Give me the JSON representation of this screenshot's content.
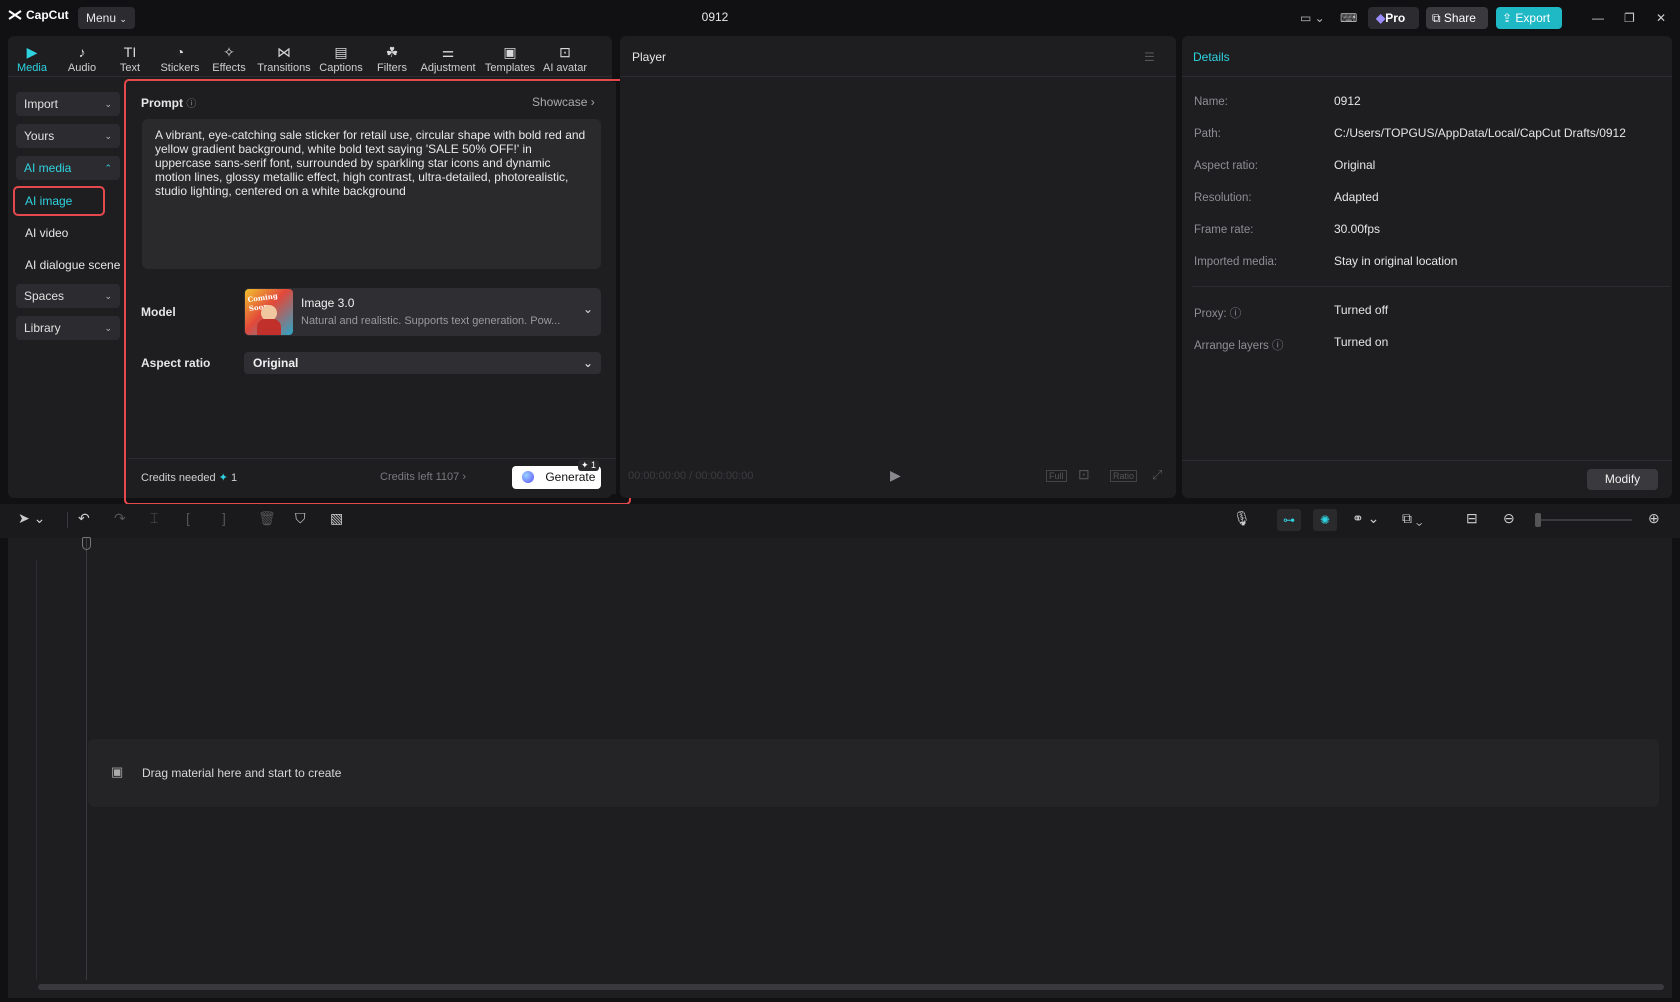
{
  "app": {
    "logo": "CapCut",
    "menu": "Menu",
    "title": "0912"
  },
  "titlebar": {
    "pro": "Pro",
    "share": "Share",
    "export": "Export"
  },
  "toolbar": {
    "tabs": [
      {
        "label": "Media",
        "icon": "media-icon"
      },
      {
        "label": "Audio",
        "icon": "audio-icon"
      },
      {
        "label": "Text",
        "icon": "text-icon"
      },
      {
        "label": "Stickers",
        "icon": "stickers-icon"
      },
      {
        "label": "Effects",
        "icon": "effects-icon"
      },
      {
        "label": "Transitions",
        "icon": "transitions-icon"
      },
      {
        "label": "Captions",
        "icon": "captions-icon"
      },
      {
        "label": "Filters",
        "icon": "filters-icon"
      },
      {
        "label": "Adjustment",
        "icon": "adjustment-icon"
      },
      {
        "label": "Templates",
        "icon": "templates-icon"
      },
      {
        "label": "AI avatar",
        "icon": "ai-avatar-icon"
      }
    ]
  },
  "sidebar": {
    "import": "Import",
    "yours": "Yours",
    "ai_media": "AI media",
    "ai_image": "AI image",
    "ai_video": "AI video",
    "ai_dialogue": "AI dialogue scene",
    "spaces": "Spaces",
    "library": "Library"
  },
  "ai_panel": {
    "prompt_label": "Prompt",
    "showcase": "Showcase",
    "prompt_text": "A vibrant, eye-catching sale sticker for retail use, circular shape with bold red and yellow gradient background, white bold text saying 'SALE 50% OFF!' in uppercase sans-serif font, surrounded by sparkling star icons and dynamic motion lines, glossy metallic effect, high contrast, ultra-detailed, photorealistic, studio lighting, centered on a white background",
    "model_label": "Model",
    "model_name": "Image 3.0",
    "model_desc": "Natural and realistic. Supports text generation. Pow...",
    "model_thumb_text": "Coming Soon",
    "aspect_label": "Aspect ratio",
    "aspect_value": "Original",
    "credits_needed": "Credits needed",
    "credits_needed_value": "1",
    "credits_left": "Credits left 1107",
    "generate": "Generate",
    "generate_badge": "1"
  },
  "player": {
    "title": "Player",
    "timecode": "00:00:00:00 / 00:00:00:00",
    "full": "Full",
    "ratio": "Ratio"
  },
  "details": {
    "title": "Details",
    "rows": [
      {
        "key": "Name:",
        "value": "0912"
      },
      {
        "key": "Path:",
        "value": "C:/Users/TOPGUS/AppData/Local/CapCut Drafts/0912"
      },
      {
        "key": "Aspect ratio:",
        "value": "Original"
      },
      {
        "key": "Resolution:",
        "value": "Adapted"
      },
      {
        "key": "Frame rate:",
        "value": "30.00fps"
      },
      {
        "key": "Imported media:",
        "value": "Stay in original location"
      },
      {
        "key": "Proxy:",
        "value": "Turned off"
      },
      {
        "key": "Arrange layers",
        "value": "Turned on"
      }
    ],
    "modify": "Modify"
  },
  "timeline": {
    "drop_hint": "Drag material here and start to create"
  },
  "colors": {
    "accent": "#2fd3e0",
    "highlight": "#e5484d",
    "panel": "#1e1e21"
  }
}
